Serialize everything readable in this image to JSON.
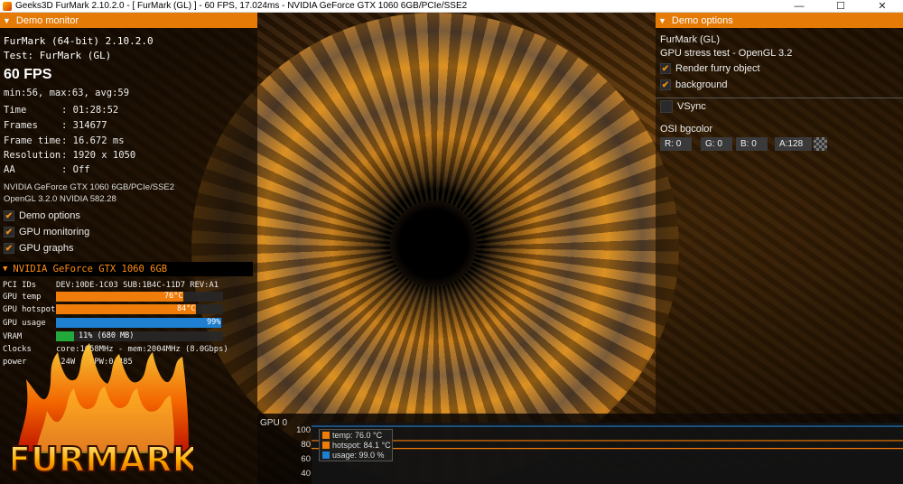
{
  "window": {
    "title": "Geeks3D FurMark 2.10.2.0 - [ FurMark (GL) ] - 60 FPS, 17.024ms - NVIDIA GeForce GTX 1060 6GB/PCIe/SSE2",
    "minimize": "—",
    "maximize": "☐",
    "close": "✕"
  },
  "demo_monitor": {
    "header": "Demo monitor",
    "app_line": "FurMark (64-bit) 2.10.2.0",
    "test_line": "Test: FurMark (GL)",
    "fps": "60 FPS",
    "minmax": "min:56, max:63, avg:59",
    "stats": [
      {
        "key": "Time",
        "value": ": 01:28:52"
      },
      {
        "key": "Frames",
        "value": ": 314677"
      },
      {
        "key": "Frame time",
        "value": ": 16.672 ms"
      },
      {
        "key": "Resolution",
        "value": ": 1920 x 1050"
      },
      {
        "key": "AA",
        "value": ": Off"
      }
    ],
    "gpu_name_line": "NVIDIA GeForce GTX 1060 6GB/PCIe/SSE2",
    "opengl_line": "OpenGL 3.2.0 NVIDIA 582.28",
    "checkboxes": [
      {
        "label": "Demo options",
        "checked": true
      },
      {
        "label": "GPU monitoring",
        "checked": true
      },
      {
        "label": "GPU graphs",
        "checked": true
      }
    ]
  },
  "gpu_monitor": {
    "header": "NVIDIA GeForce GTX 1060 6GB",
    "pci_key": "PCI IDs",
    "pci_value": "DEV:10DE-1C03 SUB:1B4C-11D7 REV:A1",
    "temp": {
      "key": "GPU temp",
      "label": "76°C",
      "fraction": 0.76,
      "color": "#f07d0a"
    },
    "hotspot": {
      "key": "GPU hotspot",
      "label": "84°C",
      "fraction": 0.84,
      "color": "#f07d0a"
    },
    "usage": {
      "key": "GPU usage",
      "label": "99%",
      "fraction": 0.99,
      "color": "#1f7fd0"
    },
    "vram": {
      "key": "VRAM",
      "label": "11% (680 MB)",
      "fraction": 0.11,
      "color": "#23a83c"
    },
    "clocks_key": "Clocks",
    "clocks_value": "core:1658MHz - mem:2004MHz (8.0Gbps)",
    "power_key": "power",
    "power_value": "124W - PPW:0.485"
  },
  "logo_text": "FURMARK",
  "demo_options": {
    "header": "Demo options",
    "name": "FurMark (GL)",
    "subtitle": "GPU stress test - OpenGL 3.2",
    "render_furry": {
      "label": "Render furry object",
      "checked": true
    },
    "background": {
      "label": "background",
      "checked": true
    },
    "vsync": {
      "label": "VSync",
      "checked": false
    },
    "osi_label": "OSI bgcolor",
    "r": "R: 0",
    "g": "G: 0",
    "b": "B: 0",
    "a": "A:128"
  },
  "graph": {
    "title": "GPU 0",
    "ticks": [
      "100",
      "80",
      "60",
      "40"
    ],
    "legend": [
      {
        "label": "temp: 76.0 °C",
        "color": "#f07d0a"
      },
      {
        "label": "hotspot: 84.1 °C",
        "color": "#f07d0a"
      },
      {
        "label": "usage: 99.0 %",
        "color": "#1f7fd0"
      }
    ],
    "series_values": {
      "usage": 99.0,
      "hotspot": 84.1,
      "temp": 76.0
    },
    "y_range": [
      40,
      100
    ]
  }
}
